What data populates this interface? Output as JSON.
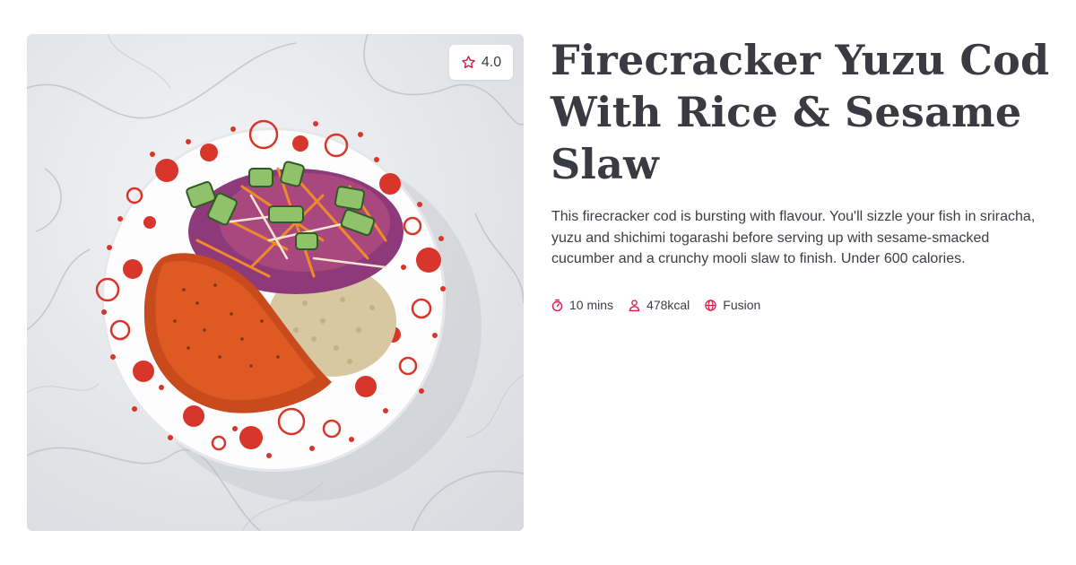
{
  "recipe": {
    "title": "Firecracker Yuzu Cod With Rice & Sesame Slaw",
    "description": "This firecracker cod is bursting with flavour. You'll sizzle your fish in sriracha, yuzu and shichimi togarashi before serving up with sesame-smacked cucumber and a crunchy mooli slaw to finish. Under 600 calories.",
    "rating": "4.0",
    "time": "10 mins",
    "calories": "478kcal",
    "cuisine": "Fusion"
  },
  "icons": {
    "rating": "star-icon",
    "time": "stopwatch-icon",
    "calories": "person-icon",
    "cuisine": "globe-icon"
  },
  "colors": {
    "accent": "#e0184a",
    "text": "#3a3b42"
  }
}
